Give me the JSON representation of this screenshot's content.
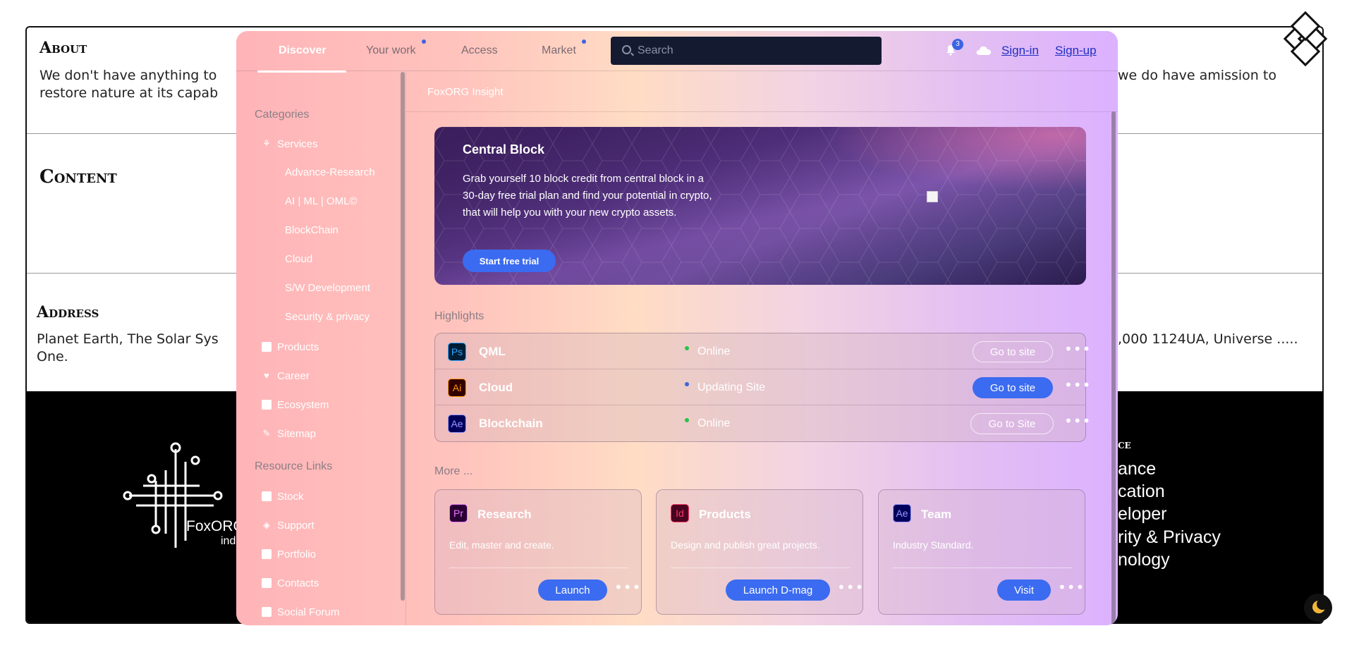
{
  "background": {
    "about": {
      "heading": "About",
      "text_left": "We don't have anything to",
      "text_left_2": "restore nature at its capab",
      "text_right": "we do have amission to"
    },
    "content": {
      "heading": "Content"
    },
    "address": {
      "heading": "Address",
      "text_left": "Planet Earth, The Solar Sys",
      "text_left_2": "One.",
      "text_right": ",000 1124UA, Universe ....."
    },
    "footer": {
      "brand": "FoxORG",
      "brand_sub": "ind",
      "heading": "ce",
      "links": [
        "ance",
        "cation",
        "eloper",
        "rity & Privacy",
        "nology"
      ]
    }
  },
  "nav": {
    "tabs": [
      "Discover",
      "Your work",
      "Access",
      "Market"
    ],
    "active_tab": "Discover",
    "search_placeholder": "Search",
    "notification_count": "3",
    "signin_label": "Sign-in",
    "signup_label": "Sign-up"
  },
  "sidebar": {
    "categories_label": "Categories",
    "services_label": "Services",
    "service_items": [
      "Advance-Research",
      "AI | ML | OML©",
      "BlockChain",
      "Cloud",
      "S/W Development",
      "Security & privacy"
    ],
    "items": [
      {
        "label": "Products",
        "icon": "product-icon"
      },
      {
        "label": "Career",
        "icon": "heart-icon"
      },
      {
        "label": "Ecosystem",
        "icon": "ecosystem-icon"
      },
      {
        "label": "Sitemap",
        "icon": "pencil-icon"
      }
    ],
    "resources_label": "Resource Links",
    "resources": [
      {
        "label": "Stock",
        "icon": "stock-icon"
      },
      {
        "label": "Support",
        "icon": "support-icon"
      },
      {
        "label": "Portfolio",
        "icon": "portfolio-icon"
      },
      {
        "label": "Contacts",
        "icon": "contacts-icon"
      },
      {
        "label": "Social Forum",
        "icon": "forum-icon"
      }
    ]
  },
  "main": {
    "breadcrumb": "FoxORG Insight",
    "hero": {
      "title": "Central Block",
      "text": "Grab yourself 10 block credit from central block in a 30-day free trial plan and find your potential in crypto, that will help you with your new crypto assets.",
      "button": "Start free trial"
    },
    "highlights_label": "Highlights",
    "highlights": [
      {
        "icon_text": "Ps",
        "name": "QML",
        "status": "Online",
        "status_color": "#29c24a",
        "button": "Go to site",
        "button_style": "outline"
      },
      {
        "icon_text": "Ai",
        "name": "Cloud",
        "status": "Updating Site",
        "status_color": "#3b63e4",
        "button": "Go to site",
        "button_style": "solid"
      },
      {
        "icon_text": "Ae",
        "name": "Blockchain",
        "status": "Online",
        "status_color": "#29c24a",
        "button": "Go to Site",
        "button_style": "outline"
      }
    ],
    "more_label": "More ...",
    "cards": [
      {
        "icon_text": "Pr",
        "title": "Research",
        "desc": "Edit, master and create.",
        "button": "Launch"
      },
      {
        "icon_text": "Id",
        "title": "Products",
        "desc": "Design and publish great projects.",
        "button": "Launch D-mag"
      },
      {
        "icon_text": "Ae",
        "title": "Team",
        "desc": "Industry Standard.",
        "button": "Visit"
      }
    ]
  },
  "colors": {
    "accent": "#3b6bf0",
    "search_bg": "#141b31",
    "online": "#29c24a",
    "updating": "#3b63e4"
  }
}
